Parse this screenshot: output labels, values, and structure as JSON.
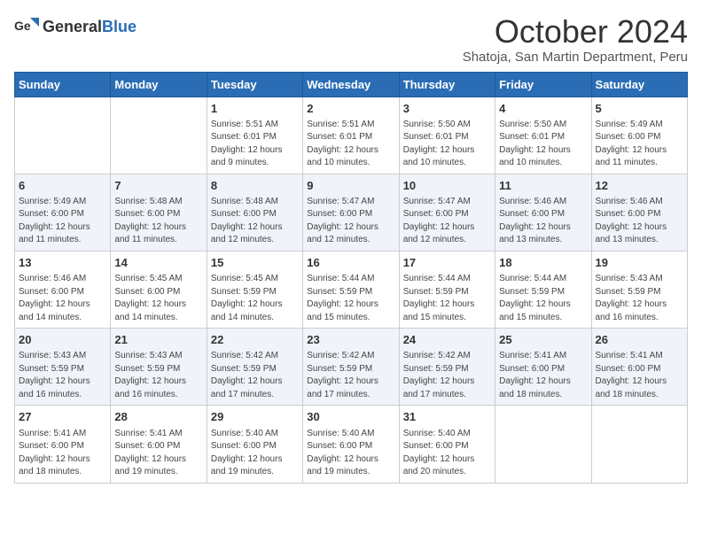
{
  "header": {
    "logo_general": "General",
    "logo_blue": "Blue",
    "title": "October 2024",
    "subtitle": "Shatoja, San Martin Department, Peru"
  },
  "days_of_week": [
    "Sunday",
    "Monday",
    "Tuesday",
    "Wednesday",
    "Thursday",
    "Friday",
    "Saturday"
  ],
  "weeks": [
    [
      {
        "day": "",
        "info": ""
      },
      {
        "day": "",
        "info": ""
      },
      {
        "day": "1",
        "info": "Sunrise: 5:51 AM\nSunset: 6:01 PM\nDaylight: 12 hours and 9 minutes."
      },
      {
        "day": "2",
        "info": "Sunrise: 5:51 AM\nSunset: 6:01 PM\nDaylight: 12 hours and 10 minutes."
      },
      {
        "day": "3",
        "info": "Sunrise: 5:50 AM\nSunset: 6:01 PM\nDaylight: 12 hours and 10 minutes."
      },
      {
        "day": "4",
        "info": "Sunrise: 5:50 AM\nSunset: 6:01 PM\nDaylight: 12 hours and 10 minutes."
      },
      {
        "day": "5",
        "info": "Sunrise: 5:49 AM\nSunset: 6:00 PM\nDaylight: 12 hours and 11 minutes."
      }
    ],
    [
      {
        "day": "6",
        "info": "Sunrise: 5:49 AM\nSunset: 6:00 PM\nDaylight: 12 hours and 11 minutes."
      },
      {
        "day": "7",
        "info": "Sunrise: 5:48 AM\nSunset: 6:00 PM\nDaylight: 12 hours and 11 minutes."
      },
      {
        "day": "8",
        "info": "Sunrise: 5:48 AM\nSunset: 6:00 PM\nDaylight: 12 hours and 12 minutes."
      },
      {
        "day": "9",
        "info": "Sunrise: 5:47 AM\nSunset: 6:00 PM\nDaylight: 12 hours and 12 minutes."
      },
      {
        "day": "10",
        "info": "Sunrise: 5:47 AM\nSunset: 6:00 PM\nDaylight: 12 hours and 12 minutes."
      },
      {
        "day": "11",
        "info": "Sunrise: 5:46 AM\nSunset: 6:00 PM\nDaylight: 12 hours and 13 minutes."
      },
      {
        "day": "12",
        "info": "Sunrise: 5:46 AM\nSunset: 6:00 PM\nDaylight: 12 hours and 13 minutes."
      }
    ],
    [
      {
        "day": "13",
        "info": "Sunrise: 5:46 AM\nSunset: 6:00 PM\nDaylight: 12 hours and 14 minutes."
      },
      {
        "day": "14",
        "info": "Sunrise: 5:45 AM\nSunset: 6:00 PM\nDaylight: 12 hours and 14 minutes."
      },
      {
        "day": "15",
        "info": "Sunrise: 5:45 AM\nSunset: 5:59 PM\nDaylight: 12 hours and 14 minutes."
      },
      {
        "day": "16",
        "info": "Sunrise: 5:44 AM\nSunset: 5:59 PM\nDaylight: 12 hours and 15 minutes."
      },
      {
        "day": "17",
        "info": "Sunrise: 5:44 AM\nSunset: 5:59 PM\nDaylight: 12 hours and 15 minutes."
      },
      {
        "day": "18",
        "info": "Sunrise: 5:44 AM\nSunset: 5:59 PM\nDaylight: 12 hours and 15 minutes."
      },
      {
        "day": "19",
        "info": "Sunrise: 5:43 AM\nSunset: 5:59 PM\nDaylight: 12 hours and 16 minutes."
      }
    ],
    [
      {
        "day": "20",
        "info": "Sunrise: 5:43 AM\nSunset: 5:59 PM\nDaylight: 12 hours and 16 minutes."
      },
      {
        "day": "21",
        "info": "Sunrise: 5:43 AM\nSunset: 5:59 PM\nDaylight: 12 hours and 16 minutes."
      },
      {
        "day": "22",
        "info": "Sunrise: 5:42 AM\nSunset: 5:59 PM\nDaylight: 12 hours and 17 minutes."
      },
      {
        "day": "23",
        "info": "Sunrise: 5:42 AM\nSunset: 5:59 PM\nDaylight: 12 hours and 17 minutes."
      },
      {
        "day": "24",
        "info": "Sunrise: 5:42 AM\nSunset: 5:59 PM\nDaylight: 12 hours and 17 minutes."
      },
      {
        "day": "25",
        "info": "Sunrise: 5:41 AM\nSunset: 6:00 PM\nDaylight: 12 hours and 18 minutes."
      },
      {
        "day": "26",
        "info": "Sunrise: 5:41 AM\nSunset: 6:00 PM\nDaylight: 12 hours and 18 minutes."
      }
    ],
    [
      {
        "day": "27",
        "info": "Sunrise: 5:41 AM\nSunset: 6:00 PM\nDaylight: 12 hours and 18 minutes."
      },
      {
        "day": "28",
        "info": "Sunrise: 5:41 AM\nSunset: 6:00 PM\nDaylight: 12 hours and 19 minutes."
      },
      {
        "day": "29",
        "info": "Sunrise: 5:40 AM\nSunset: 6:00 PM\nDaylight: 12 hours and 19 minutes."
      },
      {
        "day": "30",
        "info": "Sunrise: 5:40 AM\nSunset: 6:00 PM\nDaylight: 12 hours and 19 minutes."
      },
      {
        "day": "31",
        "info": "Sunrise: 5:40 AM\nSunset: 6:00 PM\nDaylight: 12 hours and 20 minutes."
      },
      {
        "day": "",
        "info": ""
      },
      {
        "day": "",
        "info": ""
      }
    ]
  ]
}
